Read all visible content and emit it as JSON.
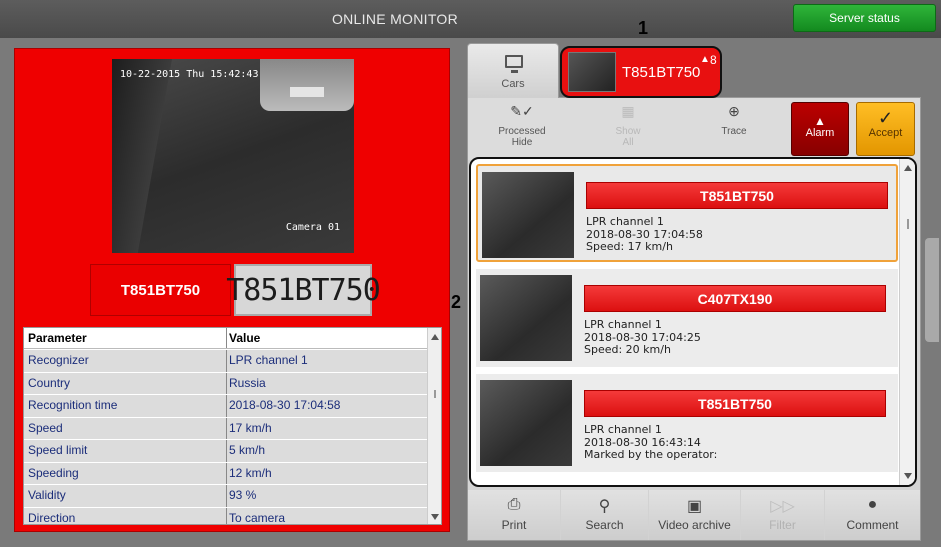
{
  "window": {
    "title": "ONLINE MONITOR"
  },
  "header": {
    "server_status": "Server status"
  },
  "camera": {
    "timestamp": "10-22-2015 Thu 15:42:43",
    "label": "Camera 01"
  },
  "recognition": {
    "plate": "T851BT750",
    "plate_image_text": "T851BT750"
  },
  "params": {
    "headers": [
      "Parameter",
      "Value"
    ],
    "rows": [
      [
        "Recognizer",
        "LPR channel 1"
      ],
      [
        "Country",
        "Russia"
      ],
      [
        "Recognition time",
        "2018-08-30 17:04:58"
      ],
      [
        "Speed",
        "17 km/h"
      ],
      [
        "Speed limit",
        "5 km/h"
      ],
      [
        "Speeding",
        "12 km/h"
      ],
      [
        "Validity",
        "93 %"
      ],
      [
        "Direction",
        "To camera"
      ]
    ]
  },
  "tabs": {
    "cars_label": "Cars",
    "alarm_plate": "T851BT750",
    "alarm_count": "8"
  },
  "markers": {
    "m1": "1",
    "m2": "2"
  },
  "toolbar": {
    "processed_hide": "Processed\nHide",
    "show_all": "Show\nAll",
    "trace": "Trace",
    "alarm": "Alarm",
    "accept": "Accept"
  },
  "events": [
    {
      "plate": "T851BT750",
      "channel": "LPR channel 1",
      "time": "2018-08-30 17:04:58",
      "extra": "Speed: 17 km/h"
    },
    {
      "plate": "C407TX190",
      "channel": "LPR channel 1",
      "time": "2018-08-30 17:04:25",
      "extra": "Speed: 20 km/h"
    },
    {
      "plate": "T851BT750",
      "channel": "LPR channel 1",
      "time": "2018-08-30 16:43:14",
      "extra": "Marked by the operator:"
    }
  ],
  "bottombar": {
    "print": "Print",
    "search": "Search",
    "video_archive": "Video archive",
    "filter": "Filter",
    "comment": "Comment"
  },
  "colors": {
    "alarm_red": "#e81010",
    "selection": "#f0a23a",
    "server_green": "#1ea02a"
  }
}
